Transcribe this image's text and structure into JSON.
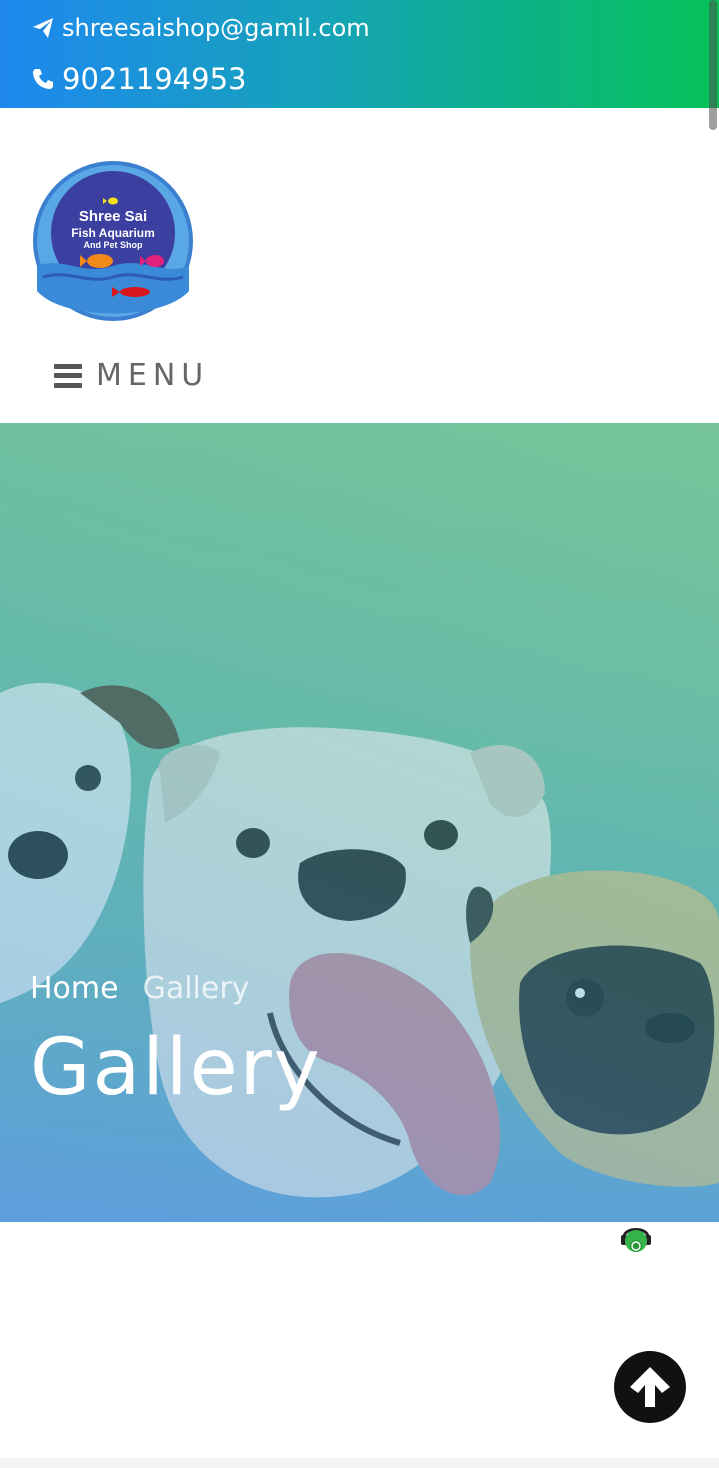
{
  "contact": {
    "email": "shreesaishop@gamil.com",
    "phone": "9021194953"
  },
  "logo": {
    "line1": "Shree Sai",
    "line2": "Fish Aquarium",
    "line3": "And Pet Shop"
  },
  "nav": {
    "menu_label": "MENU"
  },
  "breadcrumb": {
    "home": "Home",
    "current": "Gallery"
  },
  "page": {
    "title": "Gallery"
  },
  "colors": {
    "topbar_start": "#1e88f0",
    "topbar_end": "#05c257",
    "accent": "#111111"
  },
  "icons": [
    "paper-plane-icon",
    "phone-icon",
    "hamburger-icon",
    "whatsapp-chatbot-icon",
    "arrow-up-icon"
  ]
}
